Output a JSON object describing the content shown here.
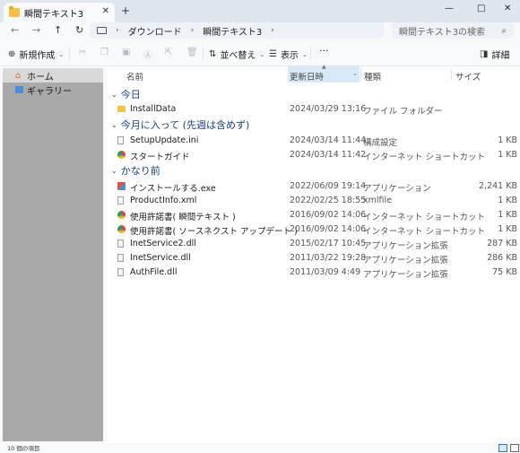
{
  "window": {
    "tab_title": "瞬間テキスト3",
    "tab_close": "✕",
    "new_tab": "+",
    "minimize": "—",
    "maximize": "□",
    "close": "✕"
  },
  "address": {
    "breadcrumbs": [
      "ダウンロード",
      "瞬間テキスト3"
    ],
    "separator": "›",
    "search_placeholder": "瞬間テキスト3の検索"
  },
  "commands": {
    "new": "新規作成",
    "sort": "並べ替え",
    "view": "表示",
    "more": "···",
    "details": "詳細"
  },
  "sidebar": {
    "items": [
      {
        "label": "ホーム",
        "icon": "home-icon",
        "active": true
      },
      {
        "label": "ギャラリー",
        "icon": "gallery-icon",
        "active": false
      }
    ]
  },
  "columns": {
    "name": "名前",
    "date": "更新日時",
    "type": "種類",
    "size": "サイズ"
  },
  "groups": [
    {
      "label": "今日",
      "files": [
        {
          "name": "InstallData",
          "date": "2024/03/29 13:16",
          "type": "ファイル フォルダー",
          "size": "",
          "icon": "folder-icon"
        }
      ]
    },
    {
      "label": "今月に入って (先週は含めず)",
      "files": [
        {
          "name": "SetupUpdate.ini",
          "date": "2024/03/14 11:44",
          "type": "構成設定",
          "size": "1 KB",
          "icon": "ini-file-icon"
        },
        {
          "name": "スタートガイド",
          "date": "2024/03/14 11:42",
          "type": "インターネット ショートカット",
          "size": "1 KB",
          "icon": "web-shortcut-icon"
        }
      ]
    },
    {
      "label": "かなり前",
      "files": [
        {
          "name": "インストールする.exe",
          "date": "2022/06/09 19:14",
          "type": "アプリケーション",
          "size": "2,241 KB",
          "icon": "exe-icon"
        },
        {
          "name": "ProductInfo.xml",
          "date": "2022/02/25 18:55",
          "type": "xmlfile",
          "size": "1 KB",
          "icon": "xml-file-icon"
        },
        {
          "name": "使用許諾書( 瞬間テキスト )",
          "date": "2016/09/02 14:06",
          "type": "インターネット ショートカット",
          "size": "1 KB",
          "icon": "web-shortcut-icon"
        },
        {
          "name": "使用許諾書( ソースネクスト アップデート )",
          "date": "2016/09/02 14:06",
          "type": "インターネット ショートカット",
          "size": "1 KB",
          "icon": "web-shortcut-icon"
        },
        {
          "name": "InetService2.dll",
          "date": "2015/02/17 10:45",
          "type": "アプリケーション拡張",
          "size": "287 KB",
          "icon": "dll-icon"
        },
        {
          "name": "InetService.dll",
          "date": "2011/03/22 19:28",
          "type": "アプリケーション拡張",
          "size": "286 KB",
          "icon": "dll-icon"
        },
        {
          "name": "AuthFile.dll",
          "date": "2011/03/09 4:49",
          "type": "アプリケーション拡張",
          "size": "75 KB",
          "icon": "dll-icon"
        }
      ]
    }
  ],
  "status": {
    "item_count": "10 個の項目"
  }
}
